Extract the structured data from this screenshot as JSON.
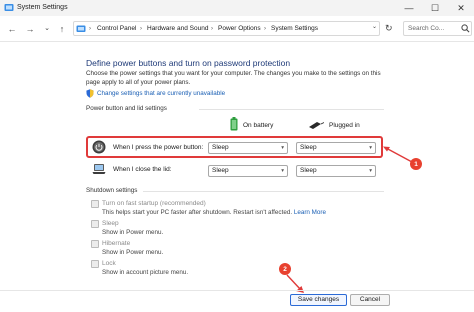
{
  "window": {
    "title": "System Settings",
    "controls": {
      "minimize": "—",
      "maximize": "☐",
      "close": "✕"
    }
  },
  "address": {
    "nav": {
      "back": "←",
      "forward": "→",
      "recent": "⌄",
      "up": "↑"
    },
    "breadcrumbs": [
      "Control Panel",
      "Hardware and Sound",
      "Power Options",
      "System Settings"
    ],
    "separator": "›",
    "dropdown": "⌄",
    "refresh": "↻",
    "search_placeholder": "Search Co..."
  },
  "main": {
    "title": "Define power buttons and turn on password protection",
    "description": "Choose the power settings that you want for your computer. The changes you make to the settings on this page apply to all of your power plans.",
    "change_link": "Change settings that are currently unavailable",
    "power_section": {
      "header": "Power button and lid settings",
      "columns": [
        "On battery",
        "Plugged in"
      ],
      "rows": [
        {
          "label": "When I press the power button:",
          "battery": "Sleep",
          "plugged": "Sleep"
        },
        {
          "label": "When I close the lid:",
          "battery": "Sleep",
          "plugged": "Sleep"
        }
      ]
    },
    "shutdown_section": {
      "header": "Shutdown settings",
      "options": [
        {
          "label": "Turn on fast startup (recommended)",
          "desc": "This helps start your PC faster after shutdown. Restart isn't affected.",
          "link": "Learn More"
        },
        {
          "label": "Sleep",
          "desc": "Show in Power menu."
        },
        {
          "label": "Hibernate",
          "desc": "Show in Power menu."
        },
        {
          "label": "Lock",
          "desc": "Show in account picture menu."
        }
      ]
    }
  },
  "annotations": {
    "badge1": "1",
    "badge2": "2",
    "color": "#e03a3a"
  },
  "footer": {
    "save": "Save changes",
    "cancel": "Cancel"
  },
  "colors": {
    "title": "#1e3a78",
    "link": "#1a5fb4",
    "accent": "#2b6ad6",
    "battery": "#2e9e3e"
  }
}
